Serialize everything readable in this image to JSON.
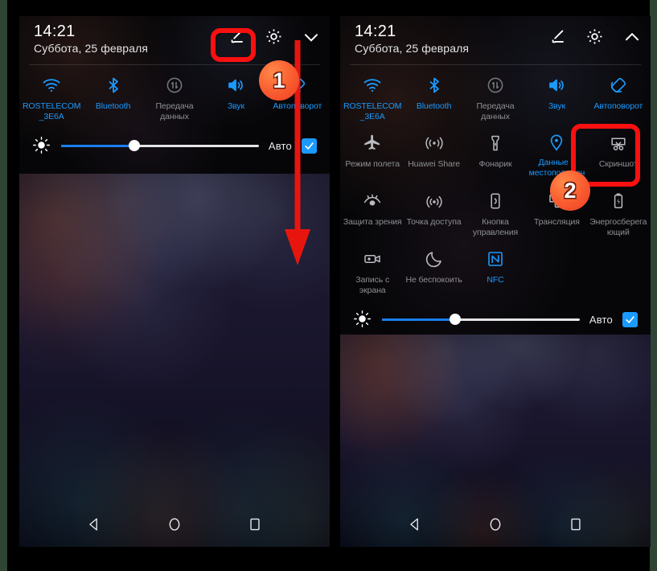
{
  "screen": {
    "status_time": "14:21",
    "status_date": "Суббота, 25 февраля",
    "accent_on": "#1a9afe",
    "accent_off": "#8d8f94",
    "highlight_color": "#fb1010",
    "badge_color": "#fb6434"
  },
  "panels": [
    {
      "id": "left-panel",
      "time": "14:21",
      "date": "Суббота, 25 февраля",
      "header_icons": [
        {
          "name": "edit-icon",
          "glyph": "pencil"
        },
        {
          "name": "settings-icon",
          "glyph": "gear"
        },
        {
          "name": "expand-icon",
          "glyph": "chevron-down"
        }
      ],
      "tiles": [
        {
          "label": "ROSTELECOM_3E6A",
          "icon": "wifi-icon",
          "state": "on"
        },
        {
          "label": "Bluetooth",
          "icon": "bluetooth-icon",
          "state": "on"
        },
        {
          "label": "Передача данных",
          "icon": "mobile-data-icon",
          "state": "off"
        },
        {
          "label": "Звук",
          "icon": "sound-icon",
          "state": "on"
        },
        {
          "label": "Автоповорот",
          "icon": "auto-rotate-icon",
          "state": "on"
        }
      ],
      "brightness": {
        "icon": "brightness-icon",
        "value_percent": 37,
        "auto_label": "Авто",
        "auto_checked": true
      },
      "nav": [
        {
          "name": "back-button",
          "glyph": "triangle"
        },
        {
          "name": "home-button",
          "glyph": "circle"
        },
        {
          "name": "recents-button",
          "glyph": "square"
        }
      ]
    },
    {
      "id": "right-panel",
      "time": "14:21",
      "date": "Суббота, 25 февраля",
      "header_icons": [
        {
          "name": "edit-icon",
          "glyph": "pencil"
        },
        {
          "name": "settings-icon",
          "glyph": "gear"
        },
        {
          "name": "collapse-icon",
          "glyph": "chevron-up"
        }
      ],
      "tiles": [
        {
          "label": "ROSTELECOM_3E6A",
          "icon": "wifi-icon",
          "state": "on"
        },
        {
          "label": "Bluetooth",
          "icon": "bluetooth-icon",
          "state": "on"
        },
        {
          "label": "Передача данных",
          "icon": "mobile-data-icon",
          "state": "off"
        },
        {
          "label": "Звук",
          "icon": "sound-icon",
          "state": "on"
        },
        {
          "label": "Автоповорот",
          "icon": "auto-rotate-icon",
          "state": "on"
        },
        {
          "label": "Режим полета",
          "icon": "airplane-icon",
          "state": "off"
        },
        {
          "label": "Huawei Share",
          "icon": "huawei-share-icon",
          "state": "off"
        },
        {
          "label": "Фонарик",
          "icon": "flashlight-icon",
          "state": "off"
        },
        {
          "label": "Данные о местоположении",
          "icon": "location-icon",
          "state": "on"
        },
        {
          "label": "Скриншот",
          "icon": "screenshot-icon",
          "state": "off"
        },
        {
          "label": "Защита зрения",
          "icon": "eye-comfort-icon",
          "state": "off"
        },
        {
          "label": "Точка доступа",
          "icon": "hotspot-icon",
          "state": "off"
        },
        {
          "label": "Кнопка управления",
          "icon": "nav-dock-icon",
          "state": "off"
        },
        {
          "label": "Трансляция",
          "icon": "cast-icon",
          "state": "off"
        },
        {
          "label": "Энергосберегающий",
          "icon": "battery-saver-icon",
          "state": "off"
        },
        {
          "label": "Запись с экрана",
          "icon": "screen-record-icon",
          "state": "off"
        },
        {
          "label": "Не беспокоить",
          "icon": "do-not-disturb-icon",
          "state": "off"
        },
        {
          "label": "NFC",
          "icon": "nfc-icon",
          "state": "on"
        }
      ],
      "brightness": {
        "icon": "brightness-icon",
        "value_percent": 37,
        "auto_label": "Авто",
        "auto_checked": true
      },
      "nav": [
        {
          "name": "back-button",
          "glyph": "triangle"
        },
        {
          "name": "home-button",
          "glyph": "circle"
        },
        {
          "name": "recents-button",
          "glyph": "square"
        }
      ]
    }
  ],
  "annotations": {
    "badge_one": "1",
    "badge_two": "2"
  }
}
